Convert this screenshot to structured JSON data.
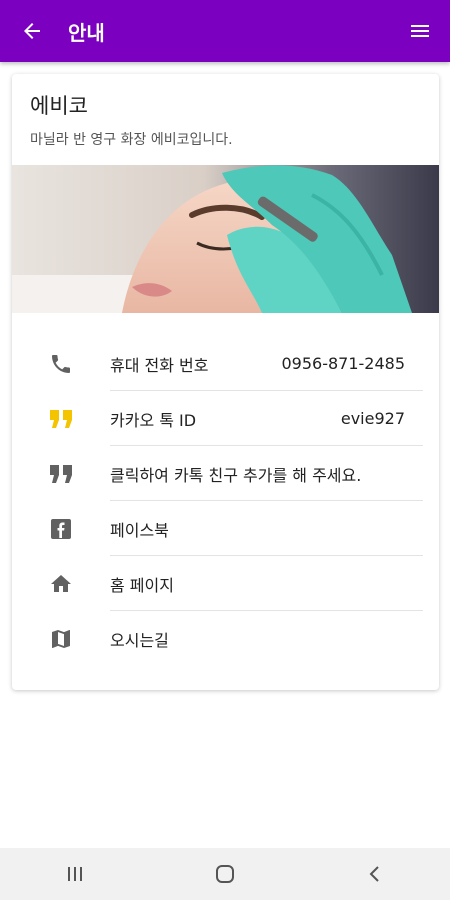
{
  "appbar": {
    "title": "안내",
    "back_icon": "arrow-back-icon",
    "menu_icon": "menu-icon",
    "color": "#7b00c0"
  },
  "card": {
    "title": "에비코",
    "subtitle": "마닐라 반 영구 화장 에비코입니다."
  },
  "info_list": [
    {
      "icon": "phone-icon",
      "label": "휴대 전화 번호",
      "value": "0956-871-2485"
    },
    {
      "icon": "kakao-quote-icon",
      "label": "카카오 톡 ID",
      "value": "evie927",
      "icon_color": "#f5c400"
    },
    {
      "icon": "quote-icon",
      "label": "클릭하여 카톡 친구 추가를 해 주세요."
    },
    {
      "icon": "facebook-icon",
      "label": "페이스북"
    },
    {
      "icon": "home-icon",
      "label": "홈 페이지"
    },
    {
      "icon": "map-icon",
      "label": "오시는길"
    }
  ],
  "system_nav": {
    "recents_icon": "recents-icon",
    "home_icon": "home-circle-icon",
    "back_icon": "nav-back-icon"
  }
}
